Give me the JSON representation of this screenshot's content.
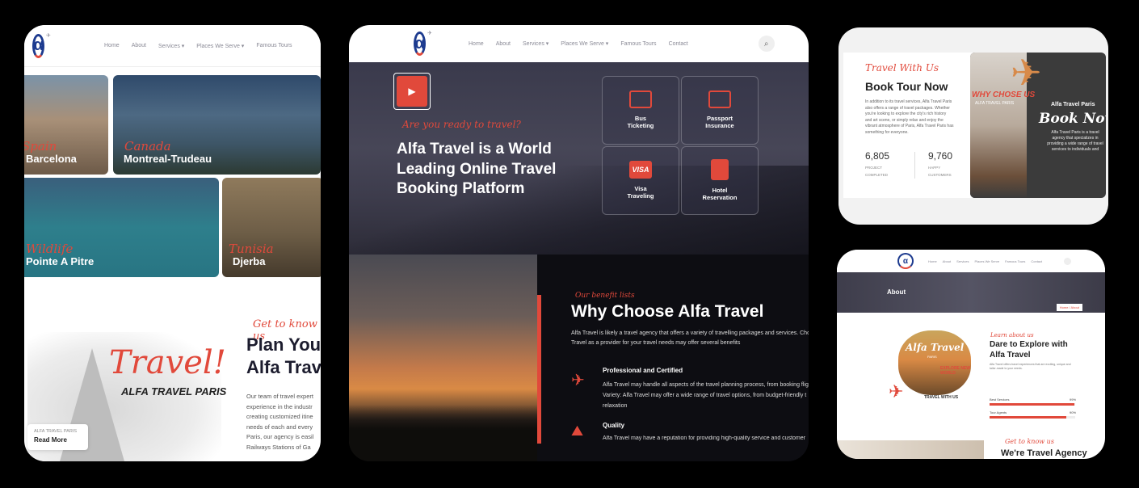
{
  "nav": {
    "home": "Home",
    "about": "About",
    "services": "Services",
    "places": "Places We Serve",
    "tours": "Famous Tours",
    "contact": "Contact"
  },
  "card1": {
    "destinations": [
      {
        "script": "Spain",
        "name": "Barcelona"
      },
      {
        "script": "Canada",
        "name": "Montreal-Trudeau"
      },
      {
        "script": "Wildlife",
        "name": "Pointe A Pitre"
      },
      {
        "script": "Tunisia",
        "name": "Djerba"
      }
    ],
    "get_to_know": "Get to know us",
    "travel_script": "Travel!",
    "brand_caption": "ALFA TRAVEL PARIS",
    "heading_line1": "Plan You",
    "heading_line2": "Alfa Trav",
    "body": "Our team of travel expert experience in the industr creating customized itine needs of each and every Paris, our agency is easil Railways Stations of Ga",
    "read_more_small": "ALFA TRAVEL PARIS",
    "read_more": "Read More"
  },
  "card2": {
    "ready": "Are you ready to travel?",
    "title_1": "Alfa Travel is a World",
    "title_2": "Leading Online Travel",
    "title_3": "Booking Platform",
    "services": [
      {
        "icon": "bus-icon",
        "l1": "Bus",
        "l2": "Ticketing"
      },
      {
        "icon": "passport-icon",
        "l1": "Passport",
        "l2": "Insurance"
      },
      {
        "icon": "visa-icon",
        "l1": "Visa",
        "l2": "Traveling",
        "badge": "VISA"
      },
      {
        "icon": "hotel-icon",
        "l1": "Hotel",
        "l2": "Reservation"
      }
    ],
    "benefit_script": "Our benefit lists",
    "why_title": "Why Choose Alfa Travel",
    "why_body_1": "Alfa Travel is likely a travel agency that offers a variety of travelling packages and services. Choo",
    "why_body_2": "Travel as a provider for your travel needs may offer several benefits",
    "feat1_title": "Professional and Certified",
    "feat1_l1": "Alfa Travel may handle all aspects of the travel planning process, from booking flig",
    "feat1_l2": "Variety: Alfa Travel may offer a wide range of travel options, from budget-friendly t",
    "feat1_l3": "relaxation",
    "feat2_title": "Quality",
    "feat2_l1": "Alfa Travel may have a reputation for providing high-quality service and customer"
  },
  "card3": {
    "script": "Travel With Us",
    "title": "Book Tour Now",
    "body": "In addition to its travel services, Alfa Travel Paris also offers a range of travel packages. Whether you're looking to explore the city's rich history and art scene, or simply relax and enjoy the vibrant atmosphere of Paris, Alfa Travel Paris has something for everyone.",
    "stat1_num": "6,805",
    "stat1_l1": "PROJECT",
    "stat1_l2": "COMPLETED",
    "stat2_num": "9,760",
    "stat2_l1": "HAPPY",
    "stat2_l2": "CUSTOMERS",
    "why_chose": "WHY CHOSE US",
    "why_sub": "ALFA TRAVEL PARIS",
    "right_brand": "Alfa Travel Paris",
    "right_title": "Book Now",
    "right_body": "Alfa Travel Paris is a travel agency that specializes in providing a wide range of travel services to individuals and groups."
  },
  "card4": {
    "banner": "About",
    "crumb": "Home / About",
    "learn": "Learn about us",
    "title_1": "Dare to Explore with",
    "title_2": "Alfa Travel",
    "body": "Alfa Travel offers travel experiences that are exciting, unique and tailor-made to your needs.",
    "poster_brand": "Alfa Travel",
    "poster_sub": "PARIS",
    "poster_explore": "EXPLORE NEW WORLD",
    "poster_with": "TRAVEL WITH US",
    "bar1_label": "Best Services",
    "bar1_value": "99%",
    "bar1_pct": 99,
    "bar2_label": "Tour Agents",
    "bar2_value": "90%",
    "bar2_pct": 90,
    "foot_script": "Get to know us",
    "foot_title": "We're Travel Agency"
  }
}
